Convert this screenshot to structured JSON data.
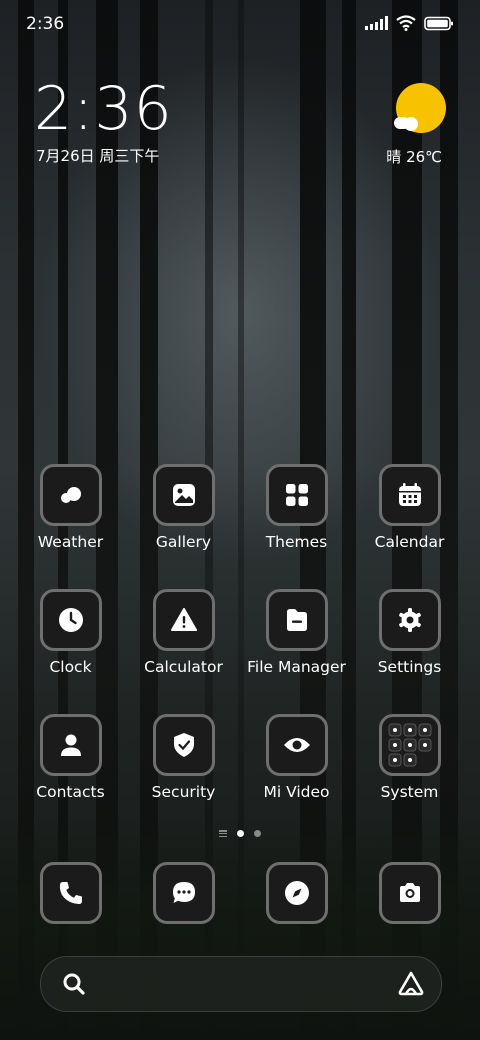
{
  "status_bar": {
    "time": "2:36"
  },
  "clock_widget": {
    "time": "2:36",
    "date": "7月26日 周三下午"
  },
  "weather_widget": {
    "text": "晴 26℃"
  },
  "apps": [
    {
      "label": "Weather",
      "icon": "weather-icon"
    },
    {
      "label": "Gallery",
      "icon": "gallery-icon"
    },
    {
      "label": "Themes",
      "icon": "themes-icon"
    },
    {
      "label": "Calendar",
      "icon": "calendar-icon"
    },
    {
      "label": "Clock",
      "icon": "clock-icon"
    },
    {
      "label": "Calculator",
      "icon": "calculator-icon"
    },
    {
      "label": "File Manager",
      "icon": "file-manager-icon"
    },
    {
      "label": "Settings",
      "icon": "gear-icon"
    },
    {
      "label": "Contacts",
      "icon": "contacts-icon"
    },
    {
      "label": "Security",
      "icon": "shield-icon"
    },
    {
      "label": "Mi Video",
      "icon": "eye-icon"
    },
    {
      "label": "System",
      "icon": "folder-grid-icon"
    }
  ],
  "dock": [
    {
      "icon": "phone-icon"
    },
    {
      "icon": "messages-icon"
    },
    {
      "icon": "compass-icon"
    },
    {
      "icon": "camera-icon"
    }
  ],
  "page_indicator": {
    "pages": 2,
    "active": 1
  },
  "colors": {
    "sun": "#f7c300",
    "icon_border": "#6f6f6f",
    "icon_bg": "#1b1b1b"
  }
}
